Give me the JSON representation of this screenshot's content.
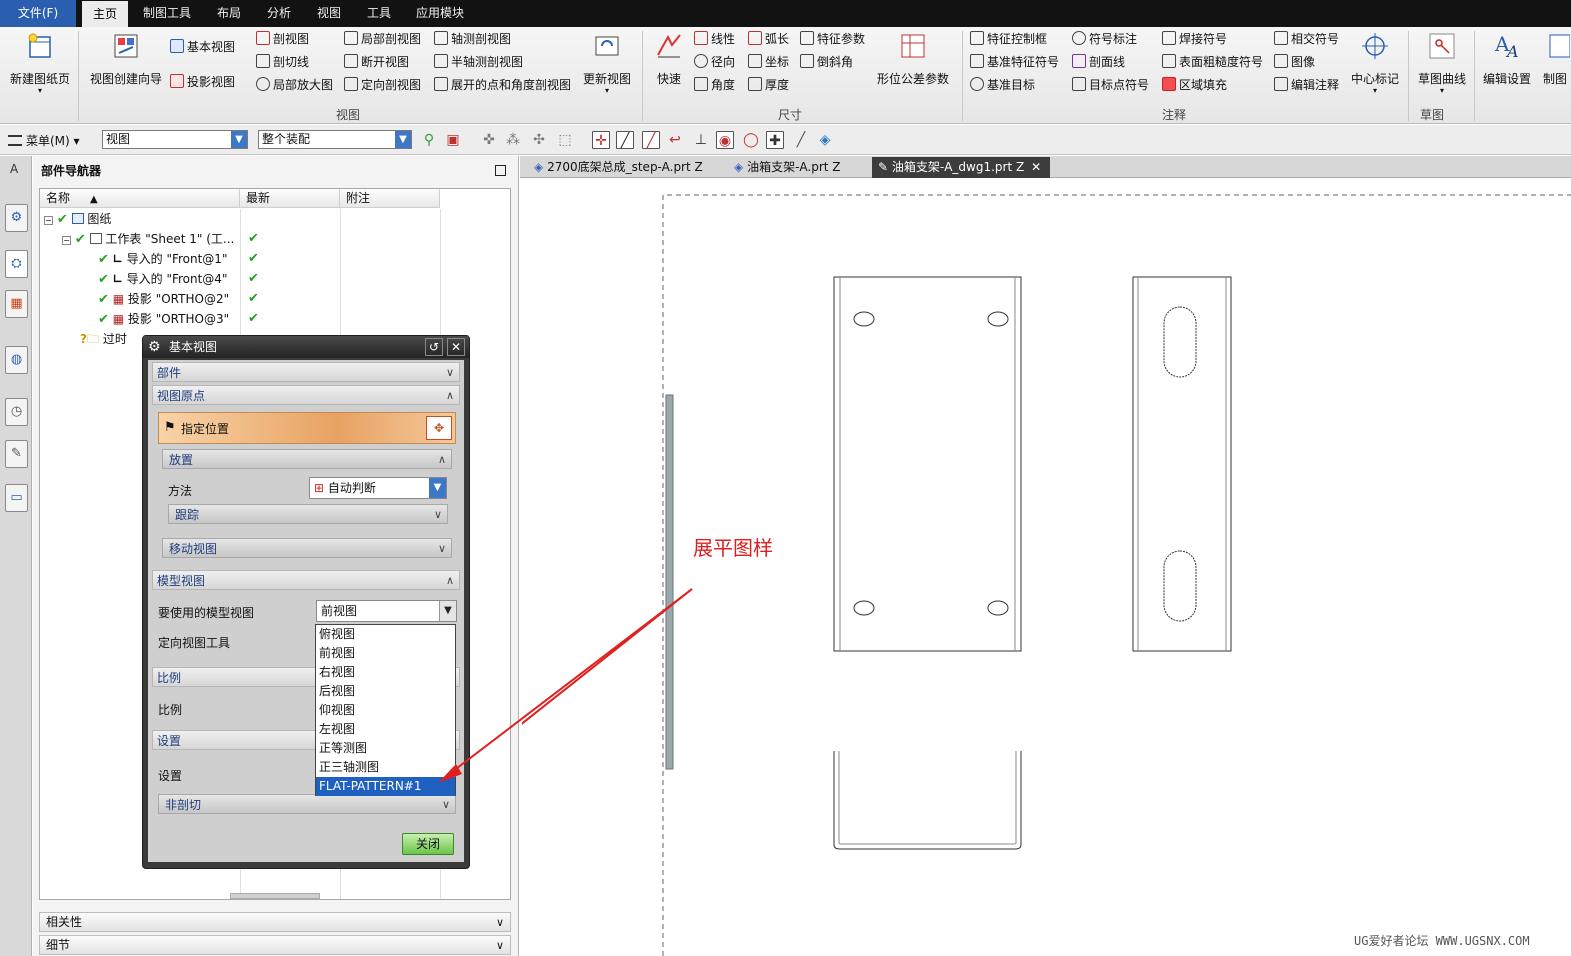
{
  "menu": {
    "tabs": [
      "文件(F)",
      "主页",
      "制图工具",
      "布局",
      "分析",
      "视图",
      "工具",
      "应用模块"
    ]
  },
  "ribbon": {
    "big_buttons": {
      "new_sheet": "新建图纸页",
      "view_wizard": "视图创建向导",
      "update_view": "更新视图",
      "quick": "快速",
      "gdt_params": "形位公差参数",
      "center_mark": "中心标记",
      "sketch_curve": "草图曲线",
      "edit_settings": "编辑设置",
      "drafting": "制图"
    },
    "view_group": {
      "base_view": "基本视图",
      "projected_view": "投影视图",
      "section_view": "剖视图",
      "section_line": "剖切线",
      "detail_view": "局部放大图",
      "break_out": "局部剖视图",
      "broken_view": "断开视图",
      "oriented_section": "定向剖视图",
      "axial_section": "轴测剖视图",
      "half_axial_section": "半轴测剖视图",
      "unfolded_section": "展开的点和角度剖视图",
      "label": "视图"
    },
    "dimension_group": {
      "linear": "线性",
      "radial": "径向",
      "angle": "角度",
      "arc_length": "弧长",
      "coordinate": "坐标",
      "thickness": "厚度",
      "feature_params": "特征参数",
      "chamfer": "倒斜角",
      "label": "尺寸"
    },
    "annotation_group": {
      "feature_control_frame": "特征控制框",
      "datum_feature_symbol": "基准特征符号",
      "datum_target": "基准目标",
      "symbol_callout": "符号标注",
      "section_line": "剖面线",
      "target_point_symbol": "目标点符号",
      "weld_symbol": "焊接符号",
      "surface_finish": "表面粗糙度符号",
      "area_fill": "区域填充",
      "intersection_symbol": "相交符号",
      "image": "图像",
      "edit_annotation": "编辑注释",
      "label": "注释"
    },
    "sketch_group_label": "草图"
  },
  "toolbar": {
    "menu_label": "菜单(M)",
    "filter_combo": "视图",
    "scope_combo": "整个装配"
  },
  "navigator": {
    "title": "部件导航器",
    "columns": [
      "名称",
      "最新",
      "附注"
    ],
    "tree": [
      {
        "label": "图纸",
        "uptodate": ""
      },
      {
        "label": "工作表 \"Sheet 1\" (工...",
        "uptodate": "✔"
      },
      {
        "label": "导入的 \"Front@1\"",
        "uptodate": "✔"
      },
      {
        "label": "导入的 \"Front@4\"",
        "uptodate": "✔"
      },
      {
        "label": "投影 \"ORTHO@2\"",
        "uptodate": "✔"
      },
      {
        "label": "投影 \"ORTHO@3\"",
        "uptodate": "✔"
      },
      {
        "label": "过时",
        "uptodate": ""
      }
    ],
    "bottom_panels": [
      "相关性",
      "细节"
    ]
  },
  "doc_tabs": [
    {
      "label": "2700底架总成_step-A.prt  Z"
    },
    {
      "label": "油箱支架-A.prt  Z"
    },
    {
      "label": "油箱支架-A_dwg1.prt  Z"
    }
  ],
  "dialog": {
    "title": "基本视图",
    "sections": {
      "part": "部件",
      "view_origin": "视图原点",
      "specify_location": "指定位置",
      "placement": "放置",
      "method_label": "方法",
      "method_value": "自动判断",
      "tracking": "跟踪",
      "move_view": "移动视图",
      "model_view": "模型视图",
      "model_view_to_use": "要使用的模型视图",
      "model_view_value": "前视图",
      "orient_view_tool": "定向视图工具",
      "scale_section": "比例",
      "scale_label": "比例",
      "settings_section": "设置",
      "settings_label": "设置",
      "non_section": "非剖切"
    },
    "options": [
      "俯视图",
      "前视图",
      "右视图",
      "后视图",
      "仰视图",
      "左视图",
      "正等测图",
      "正三轴测图",
      "FLAT-PATTERN#1"
    ],
    "selected_option": "FLAT-PATTERN#1",
    "close_button": "关闭"
  },
  "annotation": {
    "callout_text": "展平图样",
    "callout_color": "#e02020"
  },
  "watermark": "UG爱好者论坛 WWW.UGSNX.COM"
}
